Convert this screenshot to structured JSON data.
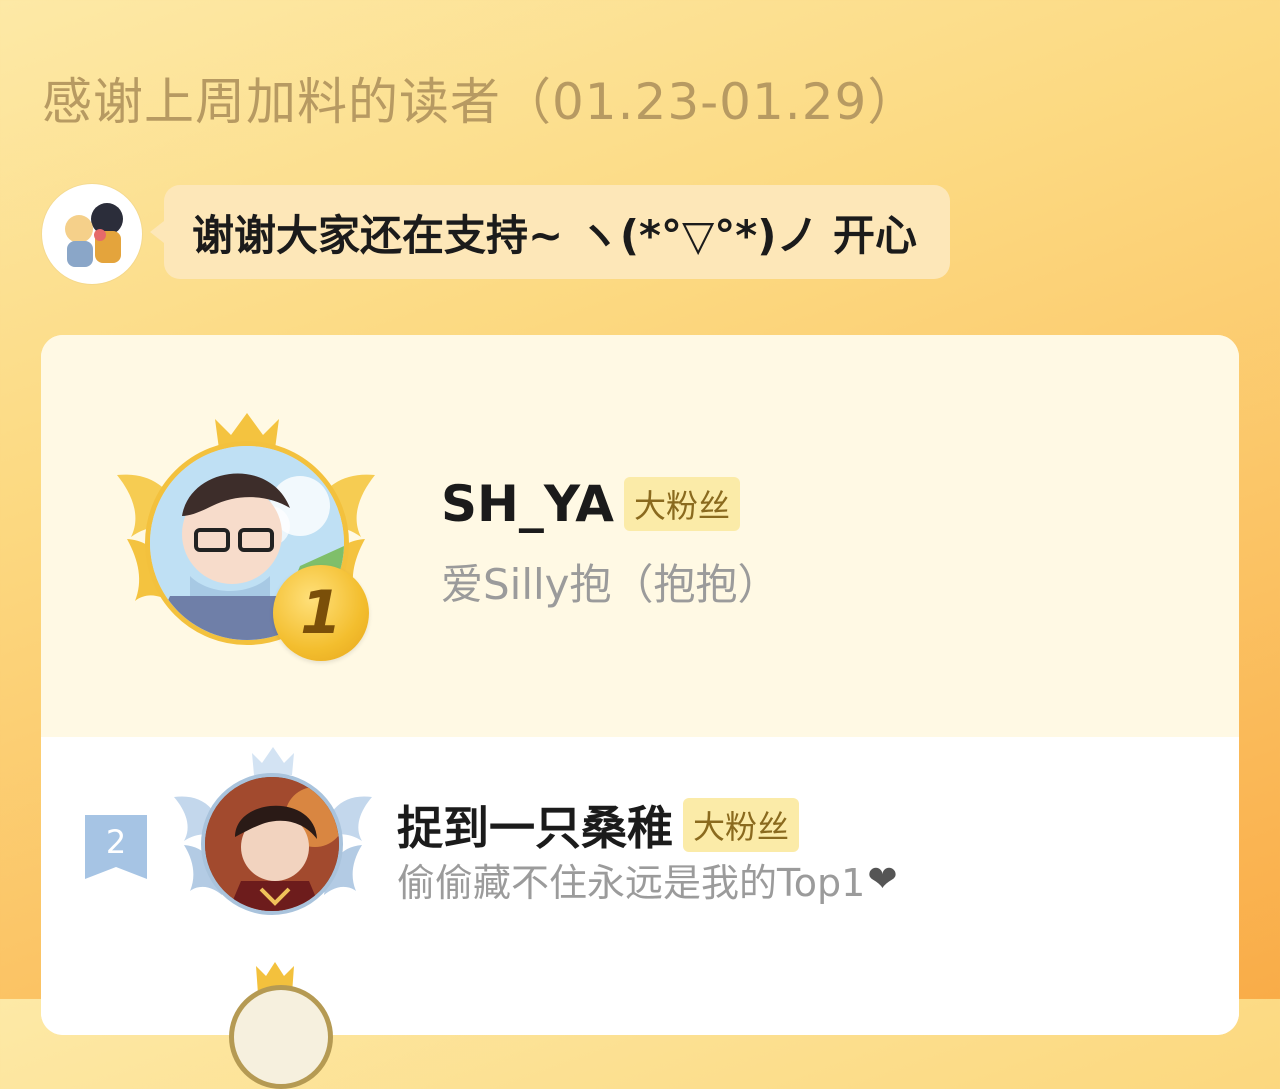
{
  "header": {
    "title": "感谢上周加料的读者（01.23-01.29）",
    "message": "谢谢大家还在支持~ ヽ(*°▽°*)ノ 开心"
  },
  "ranking": [
    {
      "rank": "1",
      "name": "SH_YA",
      "badge": "大粉丝",
      "message": "爱Silly抱（抱抱）"
    },
    {
      "rank": "2",
      "name": "捉到一只桑稚",
      "badge": "大粉丝",
      "message": "偷偷藏不住永远是我的Top1"
    }
  ],
  "icons": {
    "heart": "heart-icon",
    "crown": "crown-icon"
  },
  "colors": {
    "gold": "#f3c13d",
    "silver": "#a9c3dc",
    "badge_bg": "#fbeba8"
  }
}
